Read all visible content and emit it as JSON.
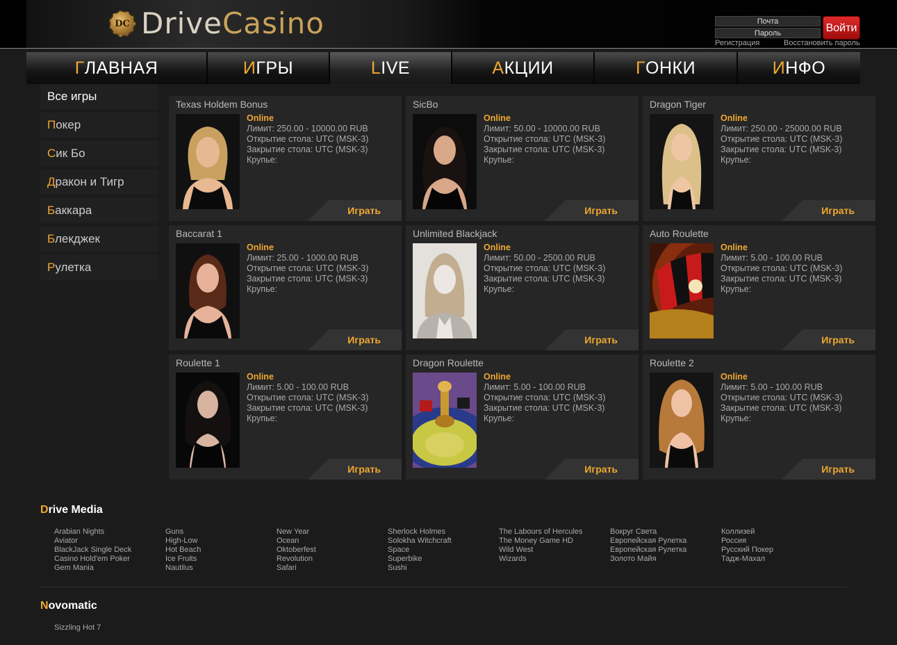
{
  "header": {
    "logo_chip": "DC",
    "logo_part1": "Drive",
    "logo_part2": "Casino",
    "email_placeholder": "Почта",
    "password_placeholder": "Пароль",
    "login_label": "Войти",
    "register_label": "Регистрация",
    "restore_label": "Восстановить пароль"
  },
  "nav": [
    {
      "first": "Г",
      "rest": "ЛАВНАЯ"
    },
    {
      "first": "И",
      "rest": "ГРЫ"
    },
    {
      "first": "L",
      "rest": "IVE"
    },
    {
      "first": "А",
      "rest": "КЦИИ"
    },
    {
      "first": "Г",
      "rest": "ОНКИ"
    },
    {
      "first": "И",
      "rest": "НФО"
    }
  ],
  "sidebar": [
    {
      "first": "",
      "rest": "Все игры"
    },
    {
      "first": "П",
      "rest": "окер"
    },
    {
      "first": "С",
      "rest": "ик Бо"
    },
    {
      "first": "Д",
      "rest": "ракон и Тигр"
    },
    {
      "first": "Б",
      "rest": "аккара"
    },
    {
      "first": "Б",
      "rest": "лекджек"
    },
    {
      "first": "Р",
      "rest": "улетка"
    }
  ],
  "tables": [
    {
      "title": "Texas Holdem Bonus",
      "status": "Online",
      "limit": "Лимит: 250.00 - 10000.00 RUB",
      "open": "Открытие стола: UTC (MSK-3)",
      "close": "Закрытие стола: UTC (MSK-3)",
      "dealer": "Крупье:",
      "play": "Играть",
      "photo": "dealer-blonde"
    },
    {
      "title": "SicBo",
      "status": "Online",
      "limit": "Лимит: 50.00 - 10000.00 RUB",
      "open": "Открытие стола: UTC (MSK-3)",
      "close": "Закрытие стола: UTC (MSK-3)",
      "dealer": "Крупье:",
      "play": "Играть",
      "photo": "dealer-brunette"
    },
    {
      "title": "Dragon Tiger",
      "status": "Online",
      "limit": "Лимит: 250.00 - 25000.00 RUB",
      "open": "Открытие стола: UTC (MSK-3)",
      "close": "Закрытие стола: UTC (MSK-3)",
      "dealer": "Крупье:",
      "play": "Играть",
      "photo": "dealer-blonde-long"
    },
    {
      "title": "Baccarat 1",
      "status": "Online",
      "limit": "Лимит: 25.00 - 1000.00 RUB",
      "open": "Открытие стола: UTC (MSK-3)",
      "close": "Закрытие стола: UTC (MSK-3)",
      "dealer": "Крупье:",
      "play": "Играть",
      "photo": "dealer-redhead"
    },
    {
      "title": "Unlimited Blackjack",
      "status": "Online",
      "limit": "Лимит: 50.00 - 2500.00 RUB",
      "open": "Открытие стола: UTC (MSK-3)",
      "close": "Закрытие стола: UTC (MSK-3)",
      "dealer": "Крупье:",
      "play": "Играть",
      "photo": "placeholder-avatar"
    },
    {
      "title": "Auto Roulette",
      "status": "Online",
      "limit": "Лимит: 5.00 - 100.00 RUB",
      "open": "Открытие стола: UTC (MSK-3)",
      "close": "Закрытие стола: UTC (MSK-3)",
      "dealer": "Крупье:",
      "play": "Играть",
      "photo": "roulette-wheel"
    },
    {
      "title": "Roulette 1",
      "status": "Online",
      "limit": "Лимит: 5.00 - 100.00 RUB",
      "open": "Открытие стола: UTC (MSK-3)",
      "close": "Закрытие стола: UTC (MSK-3)",
      "dealer": "Крупье:",
      "play": "Играть",
      "photo": "dealer-dark"
    },
    {
      "title": "Dragon Roulette",
      "status": "Online",
      "limit": "Лимит: 5.00 - 100.00 RUB",
      "open": "Открытие стола: UTC (MSK-3)",
      "close": "Закрытие стола: UTC (MSK-3)",
      "dealer": "Крупье:",
      "play": "Играть",
      "photo": "roulette-spindle"
    },
    {
      "title": "Roulette 2",
      "status": "Online",
      "limit": "Лимит: 5.00 - 100.00 RUB",
      "open": "Открытие стола: UTC (MSK-3)",
      "close": "Закрытие стола: UTC (MSK-3)",
      "dealer": "Крупье:",
      "play": "Играть",
      "photo": "dealer-auburn"
    }
  ],
  "providers": [
    {
      "first": "D",
      "rest": "rive Media",
      "columns": [
        [
          "Arabian Nights",
          "Aviator",
          "BlackJack Single Deck",
          "Casino Hold'em Poker",
          "Gem Mania"
        ],
        [
          "Guns",
          "High-Low",
          "Hot Beach",
          "Ice Fruits",
          "Nautilus"
        ],
        [
          "New Year",
          "Ocean",
          "Oktoberfest",
          "Revolution",
          "Safari"
        ],
        [
          "Sherlock Holmes",
          "Solokha Witchcraft",
          "Space",
          "Superbike",
          "Sushi"
        ],
        [
          "The Labours of Hercules",
          "The Money Game HD",
          "Wild West",
          "Wizards"
        ],
        [
          "Вокруг Света",
          "Европейская Рулетка",
          "Европейская Рулетка",
          "Золото Майя"
        ],
        [
          "Коллизей",
          "Россия",
          "Русский Покер",
          "Тадж-Махал"
        ]
      ]
    },
    {
      "first": "N",
      "rest": "ovomatic",
      "columns": [
        [
          "Sizzling Hot 7"
        ]
      ]
    }
  ],
  "colors": {
    "accent": "#f0a830",
    "login": "#c81818",
    "background": "#1b1b1b",
    "card": "#262626"
  }
}
